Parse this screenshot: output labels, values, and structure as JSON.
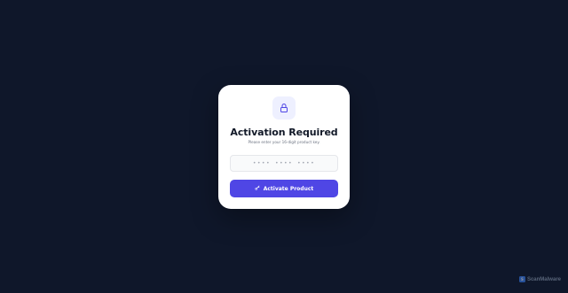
{
  "dialog": {
    "title": "Activation Required",
    "subtitle": "Please enter your 16-digit product key.",
    "key_placeholder": "•••• •••• ••••",
    "key_value": "",
    "button_label": "Activate Product",
    "button_icon": "key-icon",
    "lock_icon": "lock-icon"
  },
  "watermark": {
    "text": "ScanMalware"
  },
  "colors": {
    "background": "#0f172a",
    "card": "#ffffff",
    "accent": "#4f46e5",
    "icon_bg": "#eef0ff"
  }
}
